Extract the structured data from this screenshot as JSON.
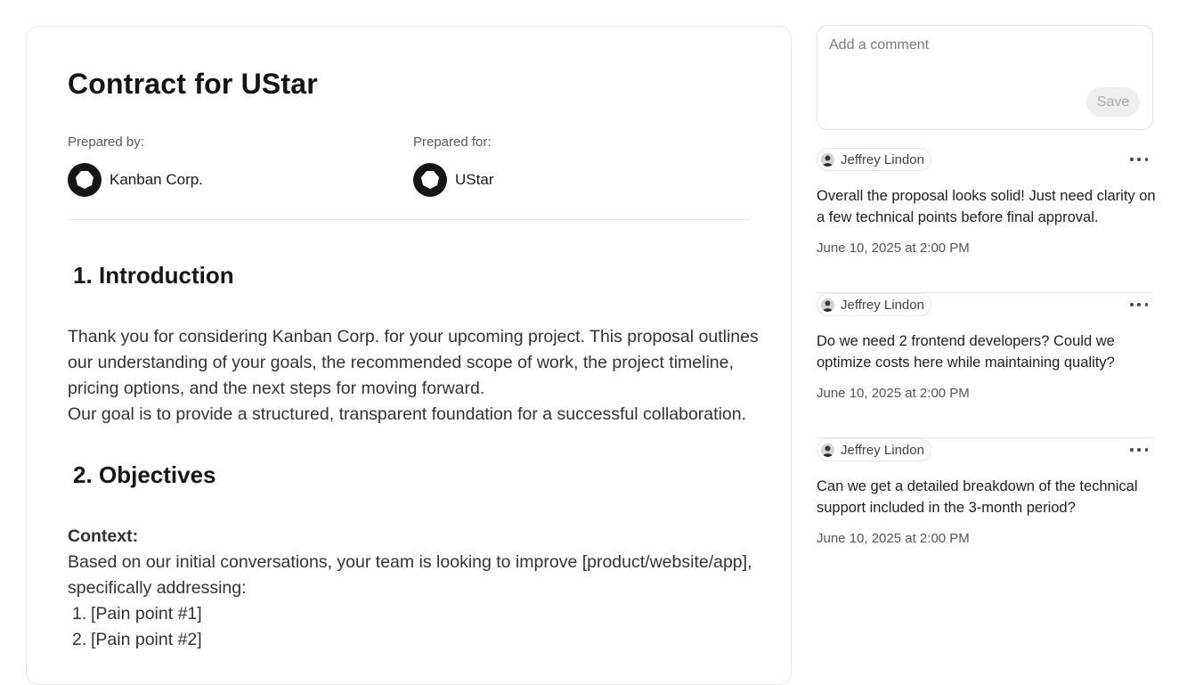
{
  "document": {
    "title": "Contract for UStar",
    "prepared_by": {
      "label": "Prepared by:",
      "name": "Kanban Corp."
    },
    "prepared_for": {
      "label": "Prepared for:",
      "name": "UStar"
    },
    "sections": [
      {
        "number": "1.",
        "heading": "Introduction",
        "lines": [
          "Thank you for considering Kanban Corp. for your upcoming project. This proposal outlines",
          "our understanding of your goals, the recommended scope of work, the project timeline,",
          "pricing options, and the next steps for moving forward.",
          "Our goal is to provide a structured, transparent foundation for a successful collaboration."
        ]
      },
      {
        "number": "2.",
        "heading": "Objectives",
        "context_label": "Context:",
        "lines": [
          "Based on our initial conversations, your team is looking to improve [product/website/app],",
          "specifically addressing:"
        ],
        "list": [
          {
            "n": "1.",
            "text": "[Pain point #1]"
          },
          {
            "n": "2.",
            "text": "[Pain point #2]"
          }
        ]
      }
    ]
  },
  "comment_box": {
    "placeholder": "Add a comment",
    "save_label": "Save"
  },
  "comments": [
    {
      "author": "Jeffrey Lindon",
      "lines": [
        "Overall the proposal looks solid! Just need clarity on",
        "a few technical points before final approval."
      ],
      "time": "June 10, 2025 at 2:00 PM"
    },
    {
      "author": "Jeffrey Lindon",
      "lines": [
        "Do we need 2 frontend developers? Could we",
        "optimize costs here while maintaining quality?"
      ],
      "time": "June 10, 2025 at 2:00 PM"
    },
    {
      "author": "Jeffrey Lindon",
      "lines": [
        "Can we get a detailed breakdown of the technical",
        "support included in the 3-month period?"
      ],
      "time": "June 10, 2025 at 2:00 PM"
    }
  ]
}
